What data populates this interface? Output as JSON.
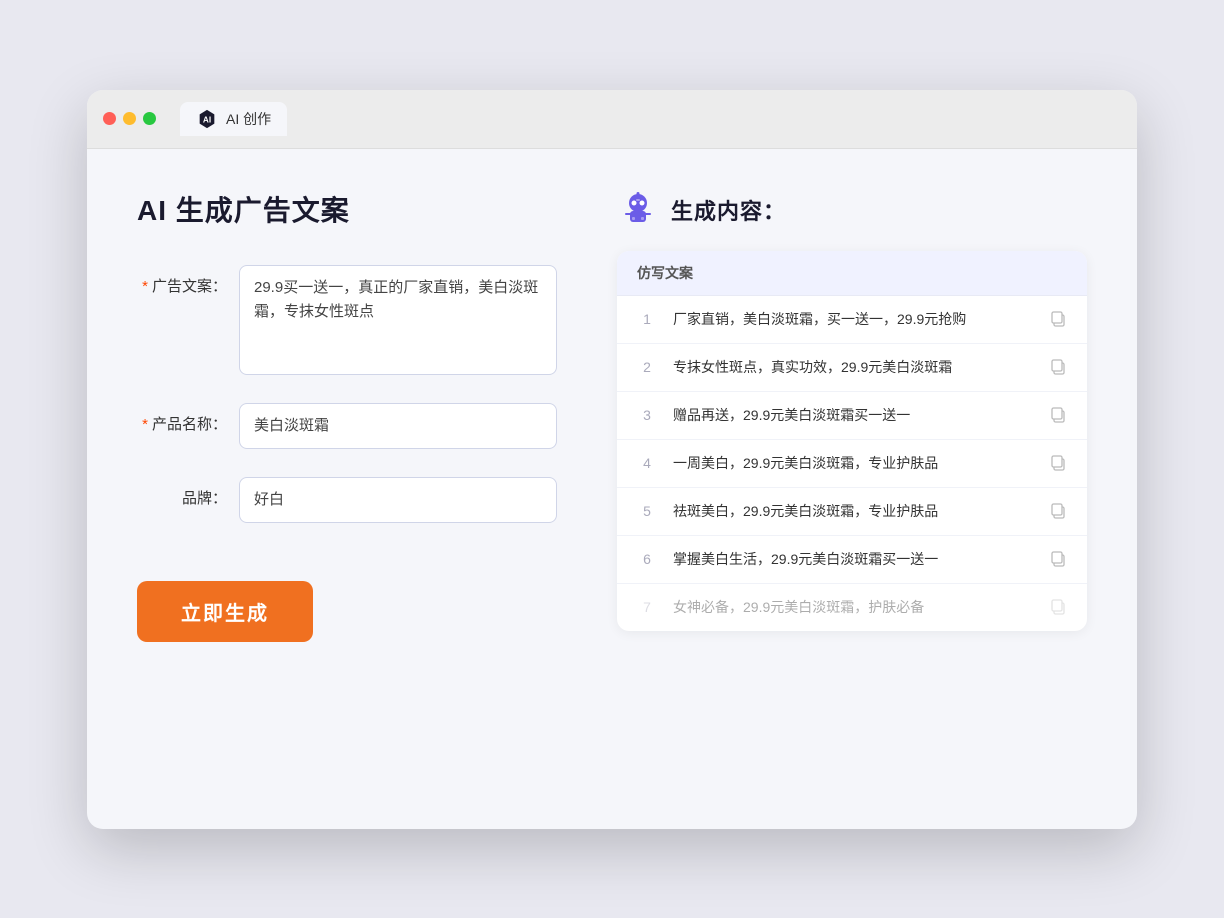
{
  "tab": {
    "label": "AI 创作"
  },
  "page": {
    "title": "AI 生成广告文案"
  },
  "form": {
    "ad_copy_label": "广告文案：",
    "ad_copy_required": "*",
    "ad_copy_value": "29.9买一送一，真正的厂家直销，美白淡斑霜，专抹女性斑点",
    "product_name_label": "产品名称：",
    "product_name_required": "*",
    "product_name_value": "美白淡斑霜",
    "brand_label": "品牌：",
    "brand_value": "好白",
    "generate_button": "立即生成"
  },
  "result": {
    "title": "生成内容：",
    "table_header": "仿写文案",
    "rows": [
      {
        "num": "1",
        "text": "厂家直销，美白淡斑霜，买一送一，29.9元抢购",
        "faded": false
      },
      {
        "num": "2",
        "text": "专抹女性斑点，真实功效，29.9元美白淡斑霜",
        "faded": false
      },
      {
        "num": "3",
        "text": "赠品再送，29.9元美白淡斑霜买一送一",
        "faded": false
      },
      {
        "num": "4",
        "text": "一周美白，29.9元美白淡斑霜，专业护肤品",
        "faded": false
      },
      {
        "num": "5",
        "text": "祛斑美白，29.9元美白淡斑霜，专业护肤品",
        "faded": false
      },
      {
        "num": "6",
        "text": "掌握美白生活，29.9元美白淡斑霜买一送一",
        "faded": false
      },
      {
        "num": "7",
        "text": "女神必备，29.9元美白淡斑霜，护肤必备",
        "faded": true
      }
    ]
  }
}
